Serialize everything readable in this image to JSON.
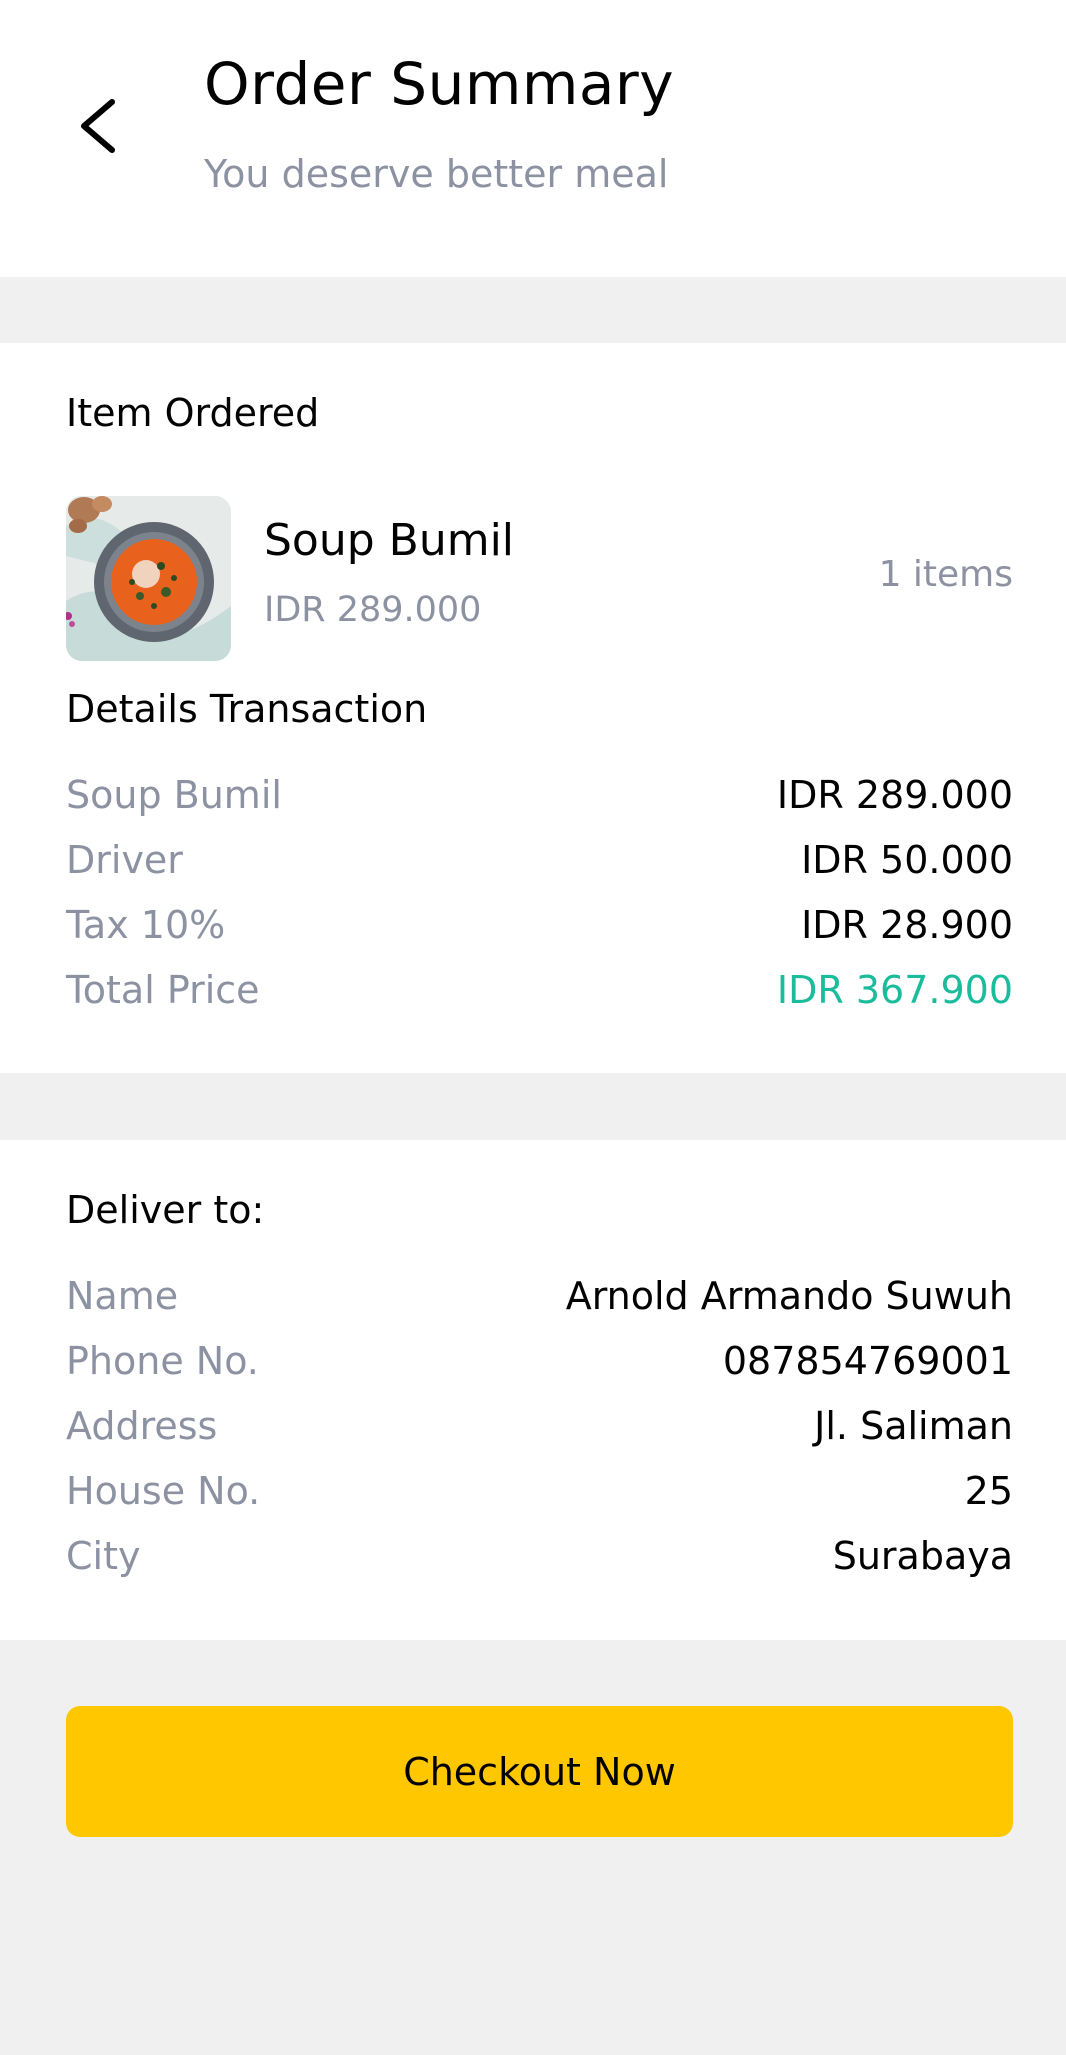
{
  "header": {
    "title": "Order Summary",
    "subtitle": "You deserve better meal",
    "back_icon": "chevron-left-icon"
  },
  "item_ordered": {
    "section_title": "Item Ordered",
    "item": {
      "name": "Soup Bumil",
      "price": "IDR 289.000",
      "count": "1 items",
      "image": "tomato-soup-bowl-photo"
    }
  },
  "transaction": {
    "section_title": "Details Transaction",
    "rows": [
      {
        "label": "Soup Bumil",
        "value": "IDR 289.000"
      },
      {
        "label": "Driver",
        "value": "IDR 50.000"
      },
      {
        "label": "Tax 10%",
        "value": "IDR 28.900"
      },
      {
        "label": "Total Price",
        "value": "IDR 367.900"
      }
    ]
  },
  "delivery": {
    "section_title": "Deliver to:",
    "rows": [
      {
        "label": "Name",
        "value": "Arnold Armando Suwuh"
      },
      {
        "label": "Phone No.",
        "value": "087854769001"
      },
      {
        "label": "Address",
        "value": "Jl. Saliman"
      },
      {
        "label": "House No.",
        "value": "25"
      },
      {
        "label": "City",
        "value": "Surabaya"
      }
    ]
  },
  "checkout": {
    "label": "Checkout Now"
  },
  "colors": {
    "accent": "#FFC700",
    "total_price": "#1ABC9C",
    "muted_text": "#8D92A3",
    "background": "#F0F0F0"
  }
}
